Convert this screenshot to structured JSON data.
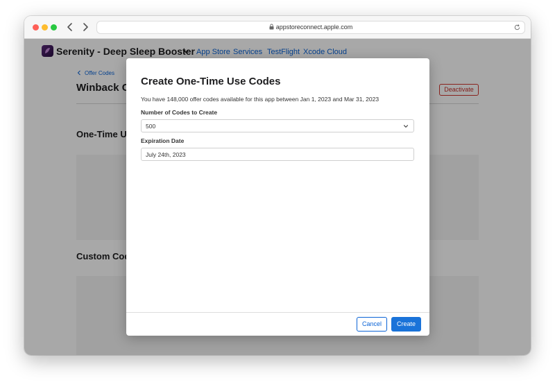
{
  "browser": {
    "url": "appstoreconnect.apple.com"
  },
  "app": {
    "name": "Serenity - Deep Sleep Booster",
    "nav": [
      "App Store",
      "Services",
      "TestFlight",
      "Xcode Cloud"
    ]
  },
  "page": {
    "breadcrumb": "Offer Codes",
    "title": "Winback C",
    "deactivate_label": "Deactivate",
    "sections": [
      "One-Time Us",
      "Custom Cod"
    ]
  },
  "modal": {
    "title": "Create One-Time Use Codes",
    "description": "You have 148,000 offer codes available for this app between Jan 1, 2023 and Mar 31, 2023",
    "codes_label": "Number of Codes to Create",
    "codes_value": "500",
    "expiration_label": "Expiration Date",
    "expiration_value": "July 24th, 2023",
    "cancel_label": "Cancel",
    "create_label": "Create"
  },
  "icons": {
    "back": "chevron-left-icon",
    "forward": "chevron-right-icon",
    "lock": "lock-icon",
    "reload": "reload-icon",
    "app": "app-icon",
    "dropdown": "chevron-down-icon"
  },
  "colors": {
    "accent": "#1a73d9",
    "danger": "#c4302b"
  }
}
